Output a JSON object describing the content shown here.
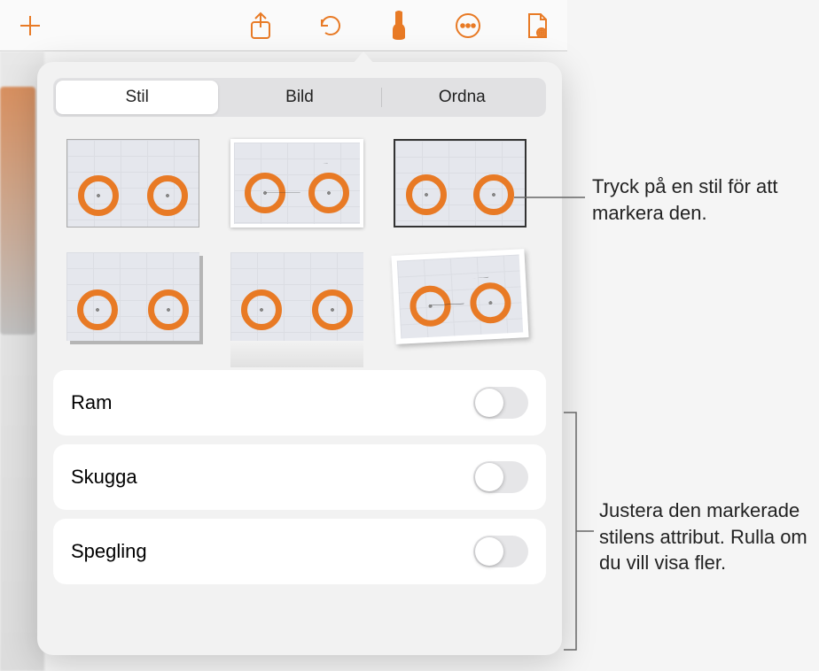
{
  "toolbar": {
    "add_icon": "plus",
    "share_icon": "share",
    "undo_icon": "undo",
    "format_icon": "brush",
    "more_icon": "more",
    "document_icon": "document-view"
  },
  "popover": {
    "tabs": [
      {
        "label": "Stil",
        "active": true
      },
      {
        "label": "Bild",
        "active": false
      },
      {
        "label": "Ordna",
        "active": false
      }
    ],
    "styles": [
      {
        "id": "style-1",
        "variant": "border1"
      },
      {
        "id": "style-2",
        "variant": "border2"
      },
      {
        "id": "style-3",
        "variant": "border3"
      },
      {
        "id": "style-4",
        "variant": "shadow1"
      },
      {
        "id": "style-5",
        "variant": "reflection"
      },
      {
        "id": "style-6",
        "variant": "tilted"
      }
    ],
    "settings": [
      {
        "label": "Ram",
        "value": false
      },
      {
        "label": "Skugga",
        "value": false
      },
      {
        "label": "Spegling",
        "value": false
      }
    ]
  },
  "callouts": {
    "top": "Tryck på en stil för att markera den.",
    "bottom": "Justera den markerade stilens attribut. Rulla om du vill visa fler."
  },
  "colors": {
    "accent": "#e87a25"
  }
}
